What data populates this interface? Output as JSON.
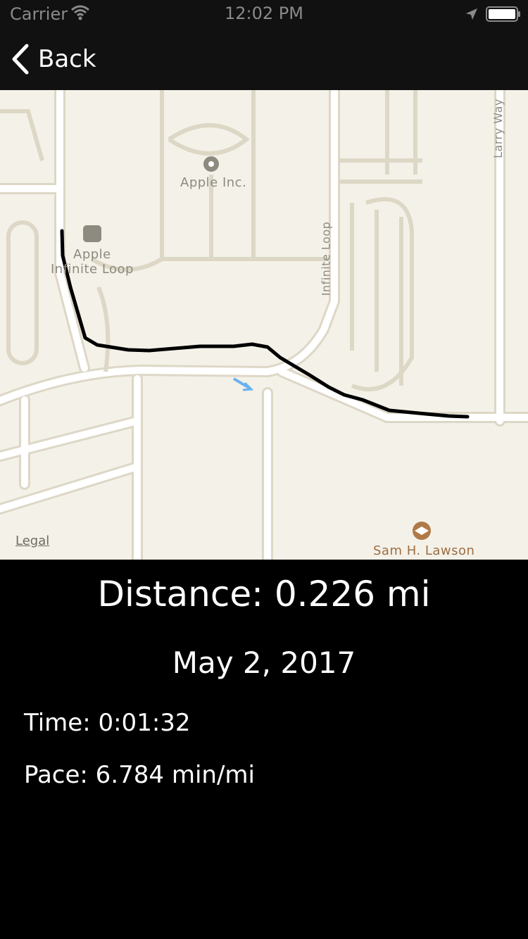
{
  "status_bar": {
    "carrier": "Carrier",
    "time": "12:02 PM"
  },
  "nav": {
    "back_label": "Back"
  },
  "map": {
    "labels": {
      "apple_inc": "Apple Inc.",
      "apple_line1": "Apple",
      "apple_line2": "Infinite Loop",
      "infinite_loop_road": "Infinite Loop",
      "larry_way": "Larry Way",
      "school": "Sam H. Lawson"
    },
    "legal": "Legal",
    "route_color": "#000000",
    "land_color": "#f4f1e8"
  },
  "stats": {
    "distance": "Distance:  0.226 mi",
    "date": "May 2, 2017",
    "time": "Time:  0:01:32",
    "pace": "Pace:  6.784 min/mi"
  }
}
